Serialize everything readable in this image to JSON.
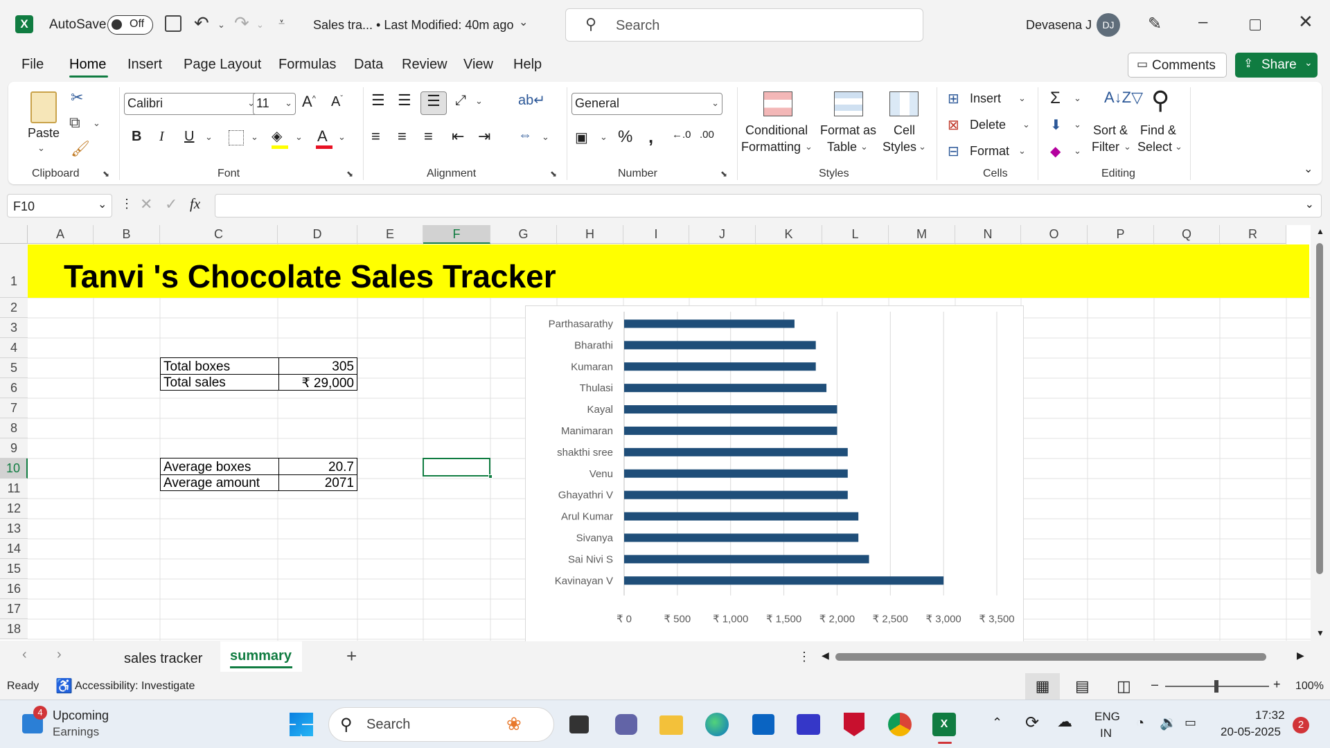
{
  "titlebar": {
    "autosave_label": "AutoSave",
    "autosave_state": "Off",
    "doc_title": "Sales tra... • Last Modified: 40m ago",
    "search_placeholder": "Search",
    "user_name": "Devasena J",
    "user_initials": "DJ"
  },
  "menu": {
    "items": [
      "File",
      "Home",
      "Insert",
      "Page Layout",
      "Formulas",
      "Data",
      "Review",
      "View",
      "Help"
    ],
    "active": "Home",
    "comments": "Comments",
    "share": "Share"
  },
  "ribbon": {
    "clipboard": {
      "paste": "Paste",
      "label": "Clipboard"
    },
    "font": {
      "name": "Calibri",
      "size": "11",
      "label": "Font"
    },
    "alignment": {
      "label": "Alignment"
    },
    "number": {
      "format": "General",
      "label": "Number"
    },
    "styles": {
      "conditional": [
        "Conditional",
        "Formatting"
      ],
      "format_table": [
        "Format as",
        "Table"
      ],
      "cell_styles": [
        "Cell",
        "Styles"
      ],
      "label": "Styles"
    },
    "cells": {
      "insert": "Insert",
      "delete": "Delete",
      "format": "Format",
      "label": "Cells"
    },
    "editing": {
      "sort": [
        "Sort &",
        "Filter"
      ],
      "find": [
        "Find &",
        "Select"
      ],
      "label": "Editing"
    }
  },
  "formula_bar": {
    "name_box": "F10",
    "fx": "fx",
    "value": ""
  },
  "grid": {
    "columns": [
      "A",
      "B",
      "C",
      "D",
      "E",
      "F",
      "G",
      "H",
      "I",
      "J",
      "K",
      "L",
      "M",
      "N",
      "O",
      "P",
      "Q",
      "R"
    ],
    "rows": [
      "1",
      "2",
      "3",
      "4",
      "5",
      "6",
      "7",
      "8",
      "9",
      "10",
      "11",
      "12",
      "13",
      "14",
      "15",
      "16",
      "17",
      "18"
    ],
    "active_cell": "F10",
    "title": "Tanvi 's Chocolate Sales Tracker",
    "summary1": [
      {
        "label": "Total boxes",
        "value": "305"
      },
      {
        "label": "Total sales",
        "value": "₹ 29,000"
      }
    ],
    "summary2": [
      {
        "label": "Average boxes",
        "value": "20.7"
      },
      {
        "label": "Average amount",
        "value": "2071"
      }
    ]
  },
  "chart_data": {
    "type": "bar",
    "orientation": "horizontal",
    "categories": [
      "Parthasarathy",
      "Bharathi",
      "Kumaran",
      "Thulasi",
      "Kayal",
      "Manimaran",
      "shakthi sree",
      "Venu",
      "Ghayathri V",
      "Arul Kumar",
      "Sivanya",
      "Sai Nivi S",
      "Kavinayan V"
    ],
    "values": [
      1600,
      1800,
      1800,
      1900,
      2000,
      2000,
      2100,
      2100,
      2100,
      2200,
      2200,
      2300,
      3000
    ],
    "x_ticks": [
      "₹ 0",
      "₹ 500",
      "₹ 1,000",
      "₹ 1,500",
      "₹ 2,000",
      "₹ 2,500",
      "₹ 3,000",
      "₹ 3,500"
    ],
    "xlim": [
      0,
      3500
    ],
    "title": "",
    "xlabel": "",
    "ylabel": "",
    "grid": true,
    "bar_color": "#1f4e79"
  },
  "sheets": {
    "tabs": [
      "sales tracker",
      "summary"
    ],
    "active": "summary",
    "add": "+"
  },
  "status": {
    "ready": "Ready",
    "accessibility": "Accessibility: Investigate",
    "zoom": "100%"
  },
  "taskbar": {
    "widget_title": "Upcoming",
    "widget_sub": "Earnings",
    "widget_badge": "4",
    "search": "Search",
    "lang1": "ENG",
    "lang2": "IN",
    "time": "17:32",
    "date": "20-05-2025",
    "notif": "2"
  },
  "colors": {
    "excel_green": "#107c41",
    "title_fill": "#ffff00",
    "chart_bar": "#1f4e79"
  }
}
